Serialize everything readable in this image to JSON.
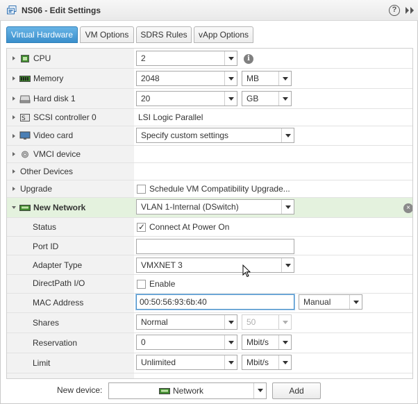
{
  "window": {
    "title": "NS06 - Edit Settings",
    "help_icon": "?",
    "icons": [
      "vm-icon",
      "help-icon",
      "expand-icon"
    ]
  },
  "tabs": [
    {
      "label": "Virtual Hardware",
      "active": true
    },
    {
      "label": "VM Options",
      "active": false
    },
    {
      "label": "SDRS Rules",
      "active": false
    },
    {
      "label": "vApp Options",
      "active": false
    }
  ],
  "hardware": {
    "cpu": {
      "label": "CPU",
      "value": "2",
      "info_icon": "i"
    },
    "memory": {
      "label": "Memory",
      "value": "2048",
      "unit": "MB"
    },
    "hard_disk": {
      "label": "Hard disk 1",
      "value": "20",
      "unit": "GB"
    },
    "scsi": {
      "label": "SCSI controller 0",
      "value": "LSI Logic Parallel"
    },
    "video": {
      "label": "Video card",
      "value": "Specify custom settings"
    },
    "vmci": {
      "label": "VMCI device"
    },
    "other": {
      "label": "Other Devices"
    },
    "upgrade": {
      "label": "Upgrade",
      "checkbox_label": "Schedule VM Compatibility Upgrade...",
      "checked": false
    }
  },
  "network": {
    "label": "New Network",
    "value": "VLAN 1-Internal (DSwitch)",
    "remove_icon": "×",
    "status": {
      "label": "Status",
      "checkbox_label": "Connect At Power On",
      "checked": true
    },
    "port_id": {
      "label": "Port ID",
      "value": ""
    },
    "adapter_type": {
      "label": "Adapter Type",
      "value": "VMXNET 3"
    },
    "directpath": {
      "label": "DirectPath I/O",
      "checkbox_label": "Enable",
      "checked": false
    },
    "mac": {
      "label": "MAC Address",
      "value": "00:50:56:93:6b:40",
      "mode": "Manual"
    },
    "shares": {
      "label": "Shares",
      "value": "Normal",
      "amount": "50"
    },
    "reservation": {
      "label": "Reservation",
      "value": "0",
      "unit": "Mbit/s"
    },
    "limit": {
      "label": "Limit",
      "value": "Unlimited",
      "unit": "Mbit/s"
    }
  },
  "footer": {
    "new_device_label": "New device:",
    "device_value": "Network",
    "add_label": "Add"
  }
}
